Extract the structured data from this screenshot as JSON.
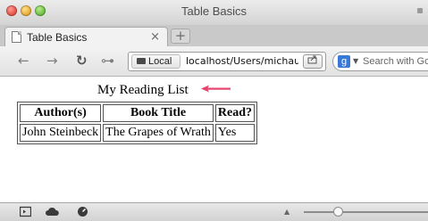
{
  "window": {
    "title": "Table Basics"
  },
  "tab": {
    "label": "Table Basics",
    "close_glyph": "×"
  },
  "new_tab": {
    "glyph": "+"
  },
  "toolbar": {
    "back_glyph": "←",
    "forward_glyph": "→",
    "reload_glyph": "↻",
    "key_glyph": "⊶"
  },
  "address_bar": {
    "chip_label": "Local",
    "url": "localhost/Users/michaud"
  },
  "search": {
    "engine_glyph": "g",
    "caret": "▼",
    "placeholder": "Search with Google"
  },
  "page": {
    "caption": "My Reading List",
    "table": {
      "headers": [
        "Author(s)",
        "Book Title",
        "Read?"
      ],
      "rows": [
        [
          "John Steinbeck",
          "The Grapes of Wrath",
          "Yes"
        ]
      ]
    }
  },
  "colors": {
    "annotation_arrow": "#e8436d"
  }
}
